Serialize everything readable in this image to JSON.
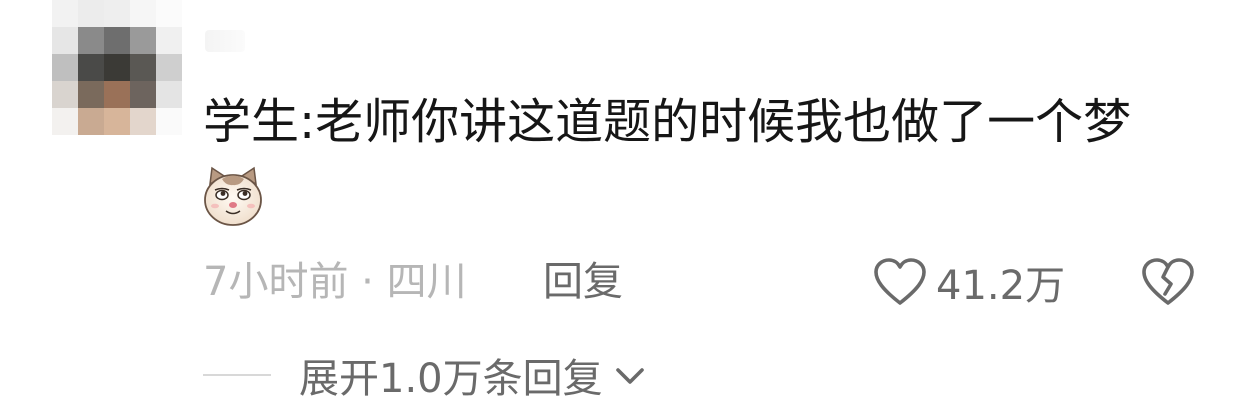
{
  "comment": {
    "text": "学生:老师你讲这道题的时候我也做了一个梦",
    "emoji_icon": "smug-cat-face-icon",
    "meta": {
      "time_location": "7小时前 · 四川",
      "reply_label": "回复"
    },
    "like": {
      "icon": "heart-outline-icon",
      "count": "41.2万"
    },
    "dislike": {
      "icon": "broken-heart-icon"
    },
    "expand": {
      "label": "展开1.0万条回复",
      "icon": "chevron-down-icon"
    }
  },
  "colors": {
    "text_primary": "#161616",
    "text_secondary": "#6a6a6a",
    "text_muted": "#b6b6b6",
    "icon_gray": "#6a6a6a"
  }
}
